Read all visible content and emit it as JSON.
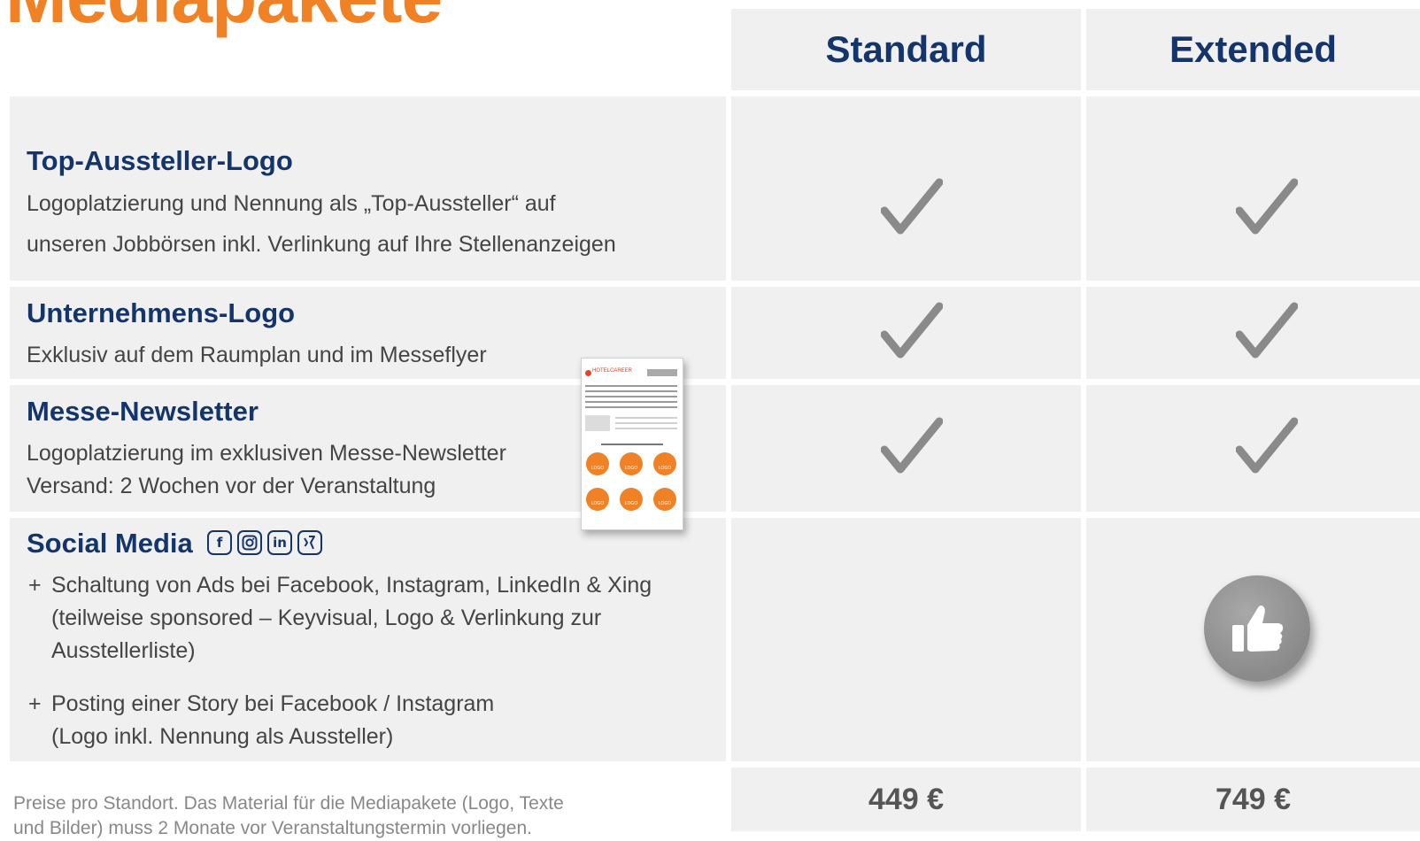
{
  "page": {
    "title": "Mediapakete"
  },
  "columns": {
    "standard": "Standard",
    "extended": "Extended"
  },
  "features": [
    {
      "title": "Top-Aussteller-Logo",
      "lines": [
        "Logoplatzierung und Nennung als „Top-Aussteller“ auf",
        "unseren Jobbörsen inkl. Verlinkung auf Ihre Stellenanzeigen"
      ]
    },
    {
      "title": "Unternehmens-Logo",
      "lines": [
        "Exklusiv auf dem Raumplan und im Messeflyer"
      ]
    },
    {
      "title": "Messe-Newsletter",
      "lines": [
        "Logoplatzierung im exklusiven Messe-Newsletter",
        "Versand: 2 Wochen vor der Veranstaltung"
      ]
    },
    {
      "title": "Social Media",
      "icons": [
        "facebook-icon",
        "instagram-icon",
        "linkedin-icon",
        "xing-icon"
      ],
      "bullets": [
        {
          "plus": "+",
          "lines": [
            "Schaltung von Ads bei Facebook, Instagram, LinkedIn & Xing",
            "(teilweise sponsored – Keyvisual, Logo & Verlinkung zur",
            "Ausstellerliste)"
          ]
        },
        {
          "plus": "+",
          "lines": [
            "Posting einer Story bei Facebook / Instagram",
            "(Logo inkl. Nennung als Aussteller)"
          ]
        }
      ]
    }
  ],
  "newsletter_preview": {
    "brand": "HOTELCAREER",
    "logo_text": "LOGO"
  },
  "prices": {
    "standard": "449 €",
    "extended": "749 €"
  },
  "footnote": {
    "line1": "Preise pro Standort. Das Material für die Mediapakete (Logo, Texte",
    "line2": "und Bilder) muss 2 Monate vor Veranstaltungstermin vorliegen."
  },
  "colors": {
    "accent": "#f08125",
    "navy": "#13356b",
    "cell": "#f0f0f0",
    "check": "#8a8a8a"
  }
}
